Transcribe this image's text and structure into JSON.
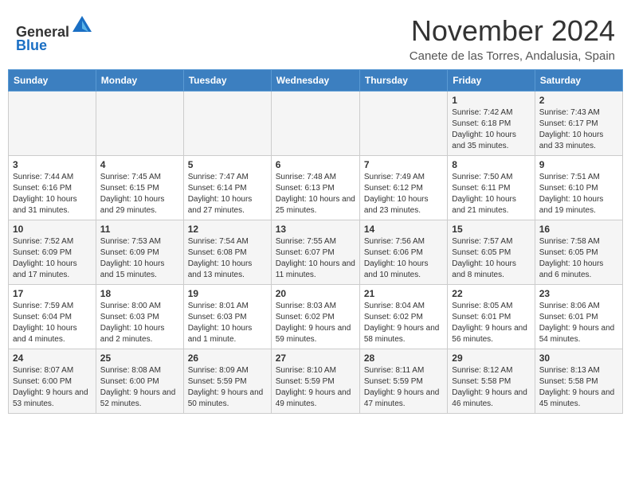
{
  "header": {
    "logo_line1": "General",
    "logo_line2": "Blue",
    "month": "November 2024",
    "location": "Canete de las Torres, Andalusia, Spain"
  },
  "days_of_week": [
    "Sunday",
    "Monday",
    "Tuesday",
    "Wednesday",
    "Thursday",
    "Friday",
    "Saturday"
  ],
  "weeks": [
    [
      {
        "day": "",
        "info": ""
      },
      {
        "day": "",
        "info": ""
      },
      {
        "day": "",
        "info": ""
      },
      {
        "day": "",
        "info": ""
      },
      {
        "day": "",
        "info": ""
      },
      {
        "day": "1",
        "info": "Sunrise: 7:42 AM\nSunset: 6:18 PM\nDaylight: 10 hours and 35 minutes."
      },
      {
        "day": "2",
        "info": "Sunrise: 7:43 AM\nSunset: 6:17 PM\nDaylight: 10 hours and 33 minutes."
      }
    ],
    [
      {
        "day": "3",
        "info": "Sunrise: 7:44 AM\nSunset: 6:16 PM\nDaylight: 10 hours and 31 minutes."
      },
      {
        "day": "4",
        "info": "Sunrise: 7:45 AM\nSunset: 6:15 PM\nDaylight: 10 hours and 29 minutes."
      },
      {
        "day": "5",
        "info": "Sunrise: 7:47 AM\nSunset: 6:14 PM\nDaylight: 10 hours and 27 minutes."
      },
      {
        "day": "6",
        "info": "Sunrise: 7:48 AM\nSunset: 6:13 PM\nDaylight: 10 hours and 25 minutes."
      },
      {
        "day": "7",
        "info": "Sunrise: 7:49 AM\nSunset: 6:12 PM\nDaylight: 10 hours and 23 minutes."
      },
      {
        "day": "8",
        "info": "Sunrise: 7:50 AM\nSunset: 6:11 PM\nDaylight: 10 hours and 21 minutes."
      },
      {
        "day": "9",
        "info": "Sunrise: 7:51 AM\nSunset: 6:10 PM\nDaylight: 10 hours and 19 minutes."
      }
    ],
    [
      {
        "day": "10",
        "info": "Sunrise: 7:52 AM\nSunset: 6:09 PM\nDaylight: 10 hours and 17 minutes."
      },
      {
        "day": "11",
        "info": "Sunrise: 7:53 AM\nSunset: 6:09 PM\nDaylight: 10 hours and 15 minutes."
      },
      {
        "day": "12",
        "info": "Sunrise: 7:54 AM\nSunset: 6:08 PM\nDaylight: 10 hours and 13 minutes."
      },
      {
        "day": "13",
        "info": "Sunrise: 7:55 AM\nSunset: 6:07 PM\nDaylight: 10 hours and 11 minutes."
      },
      {
        "day": "14",
        "info": "Sunrise: 7:56 AM\nSunset: 6:06 PM\nDaylight: 10 hours and 10 minutes."
      },
      {
        "day": "15",
        "info": "Sunrise: 7:57 AM\nSunset: 6:05 PM\nDaylight: 10 hours and 8 minutes."
      },
      {
        "day": "16",
        "info": "Sunrise: 7:58 AM\nSunset: 6:05 PM\nDaylight: 10 hours and 6 minutes."
      }
    ],
    [
      {
        "day": "17",
        "info": "Sunrise: 7:59 AM\nSunset: 6:04 PM\nDaylight: 10 hours and 4 minutes."
      },
      {
        "day": "18",
        "info": "Sunrise: 8:00 AM\nSunset: 6:03 PM\nDaylight: 10 hours and 2 minutes."
      },
      {
        "day": "19",
        "info": "Sunrise: 8:01 AM\nSunset: 6:03 PM\nDaylight: 10 hours and 1 minute."
      },
      {
        "day": "20",
        "info": "Sunrise: 8:03 AM\nSunset: 6:02 PM\nDaylight: 9 hours and 59 minutes."
      },
      {
        "day": "21",
        "info": "Sunrise: 8:04 AM\nSunset: 6:02 PM\nDaylight: 9 hours and 58 minutes."
      },
      {
        "day": "22",
        "info": "Sunrise: 8:05 AM\nSunset: 6:01 PM\nDaylight: 9 hours and 56 minutes."
      },
      {
        "day": "23",
        "info": "Sunrise: 8:06 AM\nSunset: 6:01 PM\nDaylight: 9 hours and 54 minutes."
      }
    ],
    [
      {
        "day": "24",
        "info": "Sunrise: 8:07 AM\nSunset: 6:00 PM\nDaylight: 9 hours and 53 minutes."
      },
      {
        "day": "25",
        "info": "Sunrise: 8:08 AM\nSunset: 6:00 PM\nDaylight: 9 hours and 52 minutes."
      },
      {
        "day": "26",
        "info": "Sunrise: 8:09 AM\nSunset: 5:59 PM\nDaylight: 9 hours and 50 minutes."
      },
      {
        "day": "27",
        "info": "Sunrise: 8:10 AM\nSunset: 5:59 PM\nDaylight: 9 hours and 49 minutes."
      },
      {
        "day": "28",
        "info": "Sunrise: 8:11 AM\nSunset: 5:59 PM\nDaylight: 9 hours and 47 minutes."
      },
      {
        "day": "29",
        "info": "Sunrise: 8:12 AM\nSunset: 5:58 PM\nDaylight: 9 hours and 46 minutes."
      },
      {
        "day": "30",
        "info": "Sunrise: 8:13 AM\nSunset: 5:58 PM\nDaylight: 9 hours and 45 minutes."
      }
    ]
  ]
}
